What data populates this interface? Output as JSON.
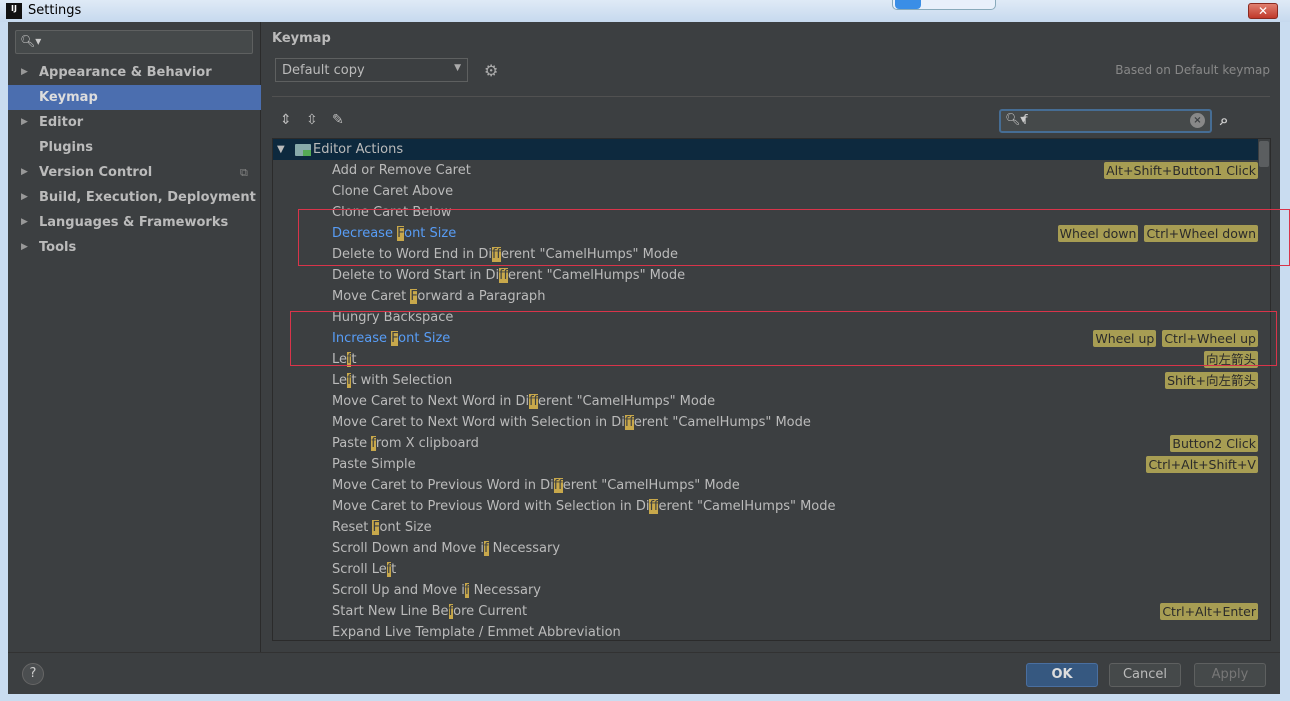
{
  "window": {
    "title": "Settings",
    "logo": "IJ",
    "close": "✕"
  },
  "sidebar": {
    "search_placeholder": "",
    "items": [
      {
        "label": "Appearance & Behavior",
        "expandable": true
      },
      {
        "label": "Keymap",
        "selected": true
      },
      {
        "label": "Editor",
        "expandable": true
      },
      {
        "label": "Plugins"
      },
      {
        "label": "Version Control",
        "expandable": true,
        "copy_icon": true
      },
      {
        "label": "Build, Execution, Deployment",
        "expandable": true
      },
      {
        "label": "Languages & Frameworks",
        "expandable": true
      },
      {
        "label": "Tools",
        "expandable": true
      }
    ]
  },
  "main": {
    "title": "Keymap",
    "keymap_select": "Default copy",
    "based_on": "Based on Default keymap",
    "search_value": "f",
    "tree_root": "Editor Actions",
    "actions": [
      {
        "parts": [
          "Add or Remove Caret"
        ],
        "shortcuts": [
          "Alt+Shift+Button1 Click"
        ]
      },
      {
        "parts": [
          "Clone Caret Above"
        ],
        "shortcuts": []
      },
      {
        "parts": [
          "Clone Caret Below"
        ],
        "shortcuts": []
      },
      {
        "parts": [
          "Decrease ",
          "F",
          "ont Size"
        ],
        "shortcuts": [
          "Wheel down",
          "Ctrl+Wheel down"
        ],
        "highlighted": true
      },
      {
        "parts": [
          "Delete to Word End in Di",
          "ff",
          "erent \"CamelHumps\" Mode"
        ],
        "shortcuts": []
      },
      {
        "parts": [
          "Delete to Word Start in Di",
          "ff",
          "erent \"CamelHumps\" Mode"
        ],
        "shortcuts": []
      },
      {
        "parts": [
          "Move Caret ",
          "F",
          "orward a Paragraph"
        ],
        "shortcuts": []
      },
      {
        "parts": [
          "Hungry Backspace"
        ],
        "shortcuts": []
      },
      {
        "parts": [
          "Increase ",
          "F",
          "ont Size"
        ],
        "shortcuts": [
          "Wheel up",
          "Ctrl+Wheel up"
        ],
        "highlighted": true
      },
      {
        "parts": [
          "Le",
          "f",
          "t"
        ],
        "shortcuts": [
          "向左箭头"
        ]
      },
      {
        "parts": [
          "Le",
          "f",
          "t with Selection"
        ],
        "shortcuts": [
          "Shift+向左箭头"
        ]
      },
      {
        "parts": [
          "Move Caret to Next Word in Di",
          "ff",
          "erent \"CamelHumps\" Mode"
        ],
        "shortcuts": []
      },
      {
        "parts": [
          "Move Caret to Next Word with Selection in Di",
          "ff",
          "erent \"CamelHumps\" Mode"
        ],
        "shortcuts": []
      },
      {
        "parts": [
          "Paste ",
          "f",
          "rom X clipboard"
        ],
        "shortcuts": [
          "Button2 Click"
        ]
      },
      {
        "parts": [
          "Paste Simple"
        ],
        "shortcuts": [
          "Ctrl+Alt+Shift+V"
        ]
      },
      {
        "parts": [
          "Move Caret to Previous Word in Di",
          "ff",
          "erent \"CamelHumps\" Mode"
        ],
        "shortcuts": []
      },
      {
        "parts": [
          "Move Caret to Previous Word with Selection in Di",
          "ff",
          "erent \"CamelHumps\" Mode"
        ],
        "shortcuts": []
      },
      {
        "parts": [
          "Reset ",
          "F",
          "ont Size"
        ],
        "shortcuts": []
      },
      {
        "parts": [
          "Scroll Down and Move i",
          "f",
          " Necessary"
        ],
        "shortcuts": []
      },
      {
        "parts": [
          "Scroll Le",
          "f",
          "t"
        ],
        "shortcuts": []
      },
      {
        "parts": [
          "Scroll Up and Move i",
          "f",
          " Necessary"
        ],
        "shortcuts": []
      },
      {
        "parts": [
          "Start New Line Be",
          "f",
          "ore Current"
        ],
        "shortcuts": [
          "Ctrl+Alt+Enter"
        ]
      },
      {
        "parts": [
          "Expand Live Template / Emmet Abbreviation"
        ],
        "shortcuts": []
      }
    ]
  },
  "footer": {
    "help": "?",
    "ok": "OK",
    "cancel": "Cancel",
    "apply": "Apply"
  },
  "colors": {
    "accent": "#4b6eaf",
    "match": "#c8a84b",
    "shortcut": "#a79d53",
    "link": "#589df6",
    "annotation": "#d9344a"
  }
}
